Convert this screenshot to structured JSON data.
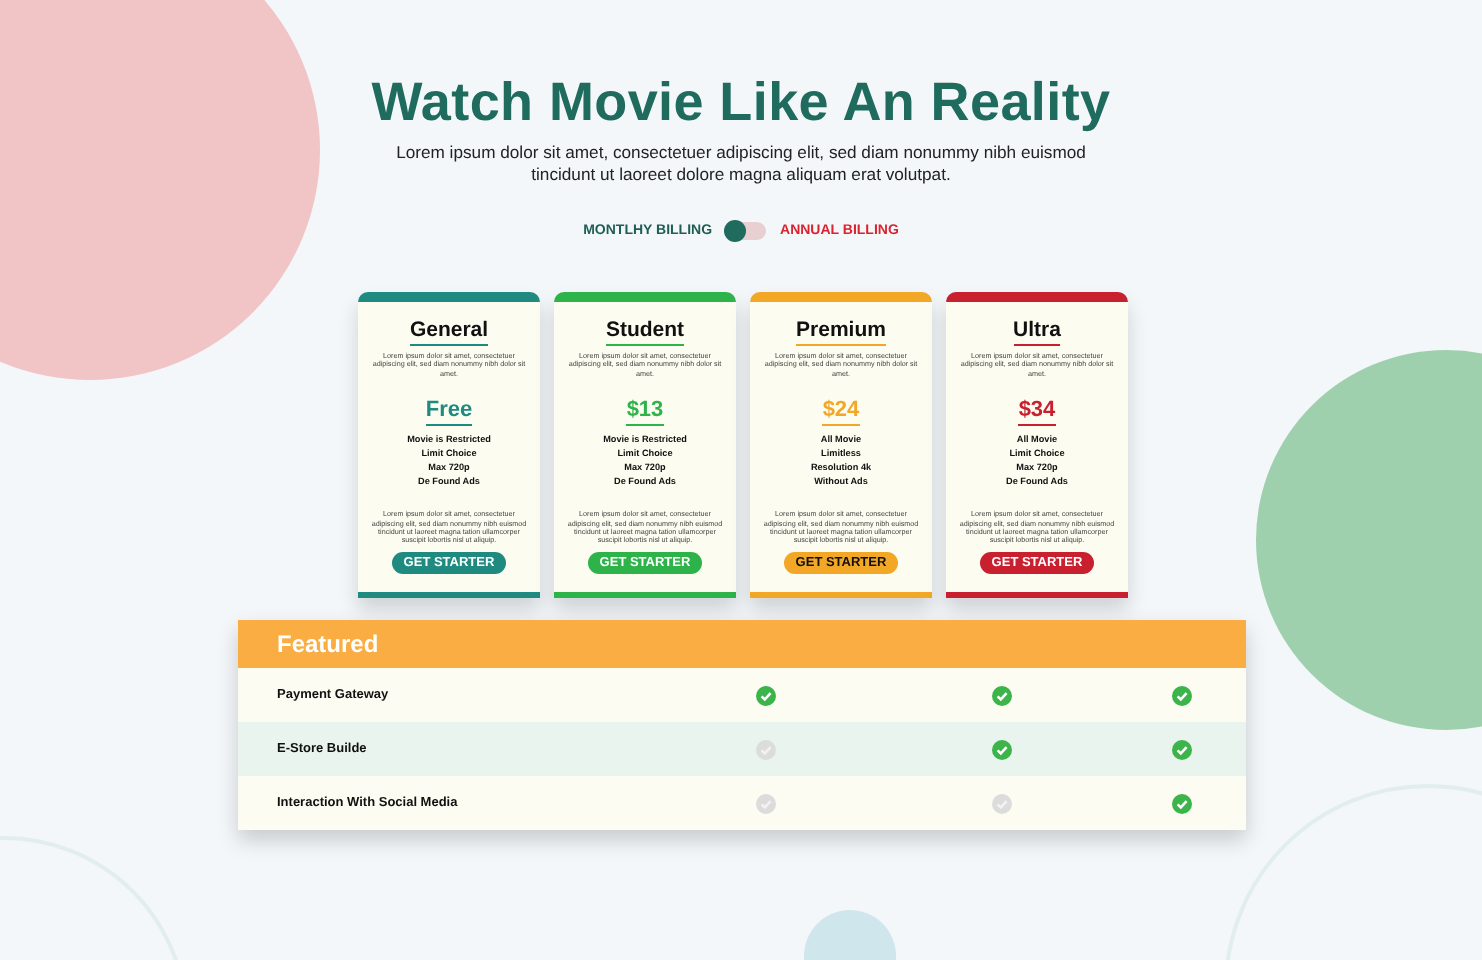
{
  "header": {
    "title": "Watch Movie Like An Reality",
    "subtitle": "Lorem ipsum dolor sit amet, consectetuer adipiscing elit, sed diam nonummy nibh euismod tincidunt ut laoreet dolore magna aliquam erat volutpat."
  },
  "billing": {
    "monthly_label": "MONTLHY BILLING",
    "annual_label": "ANNUAL BILLING",
    "annual": false
  },
  "plans": [
    {
      "name": "General",
      "color": "#1f8a7f",
      "description": "Lorem ipsum dolor sit amet, consectetuer adipiscing elit, sed diam nonummy nibh dolor sit amet.",
      "price": "Free",
      "features": [
        "Movie is Restricted",
        "Limit Choice",
        "Max 720p",
        "De Found Ads"
      ],
      "note": "Lorem ipsum dolor sit amet, consectetuer adipiscing elit, sed diam nonummy nibh euismod tincidunt ut laoreet magna tation ullamcorper suscipit lobortis nisl ut aliquip.",
      "button": "GET STARTER"
    },
    {
      "name": "Student",
      "color": "#2db34a",
      "description": "Lorem ipsum dolor sit amet, consectetuer adipiscing elit, sed diam nonummy nibh dolor sit amet.",
      "price": "$13",
      "features": [
        "Movie is Restricted",
        "Limit Choice",
        "Max 720p",
        "De Found Ads"
      ],
      "note": "Lorem ipsum dolor sit amet, consectetuer adipiscing elit, sed diam nonummy nibh euismod tincidunt ut laoreet magna tation ullamcorper suscipit lobortis nisl ut aliquip.",
      "button": "GET STARTER"
    },
    {
      "name": "Premium",
      "color": "#f2a726",
      "description": "Lorem ipsum dolor sit amet, consectetuer adipiscing elit, sed diam nonummy nibh dolor sit amet.",
      "price": "$24",
      "features": [
        "All Movie",
        "Limitless",
        "Resolution 4k",
        "Without Ads"
      ],
      "note": "Lorem ipsum dolor sit amet, consectetuer adipiscing elit, sed diam nonummy nibh euismod tincidunt ut laoreet magna tation ullamcorper suscipit lobortis nisl ut aliquip.",
      "button": "GET STARTER"
    },
    {
      "name": "Ultra",
      "color": "#c8202f",
      "description": "Lorem ipsum dolor sit amet, consectetuer adipiscing elit, sed diam nonummy nibh dolor sit amet.",
      "price": "$34",
      "features": [
        "All Movie",
        "Limit Choice",
        "Max 720p",
        "De Found Ads"
      ],
      "note": "Lorem ipsum dolor sit amet, consectetuer adipiscing elit, sed diam nonummy nibh euismod tincidunt ut laoreet magna tation ullamcorper suscipit lobortis nisl ut aliquip.",
      "button": "GET STARTER"
    }
  ],
  "features_table": {
    "title": "Featured",
    "rows": [
      {
        "name": "Payment Gateway",
        "included": [
          true,
          true,
          true
        ]
      },
      {
        "name": "E-Store Builde",
        "included": [
          false,
          true,
          true
        ]
      },
      {
        "name": "Interaction With Social Media",
        "included": [
          false,
          false,
          true
        ]
      }
    ]
  }
}
